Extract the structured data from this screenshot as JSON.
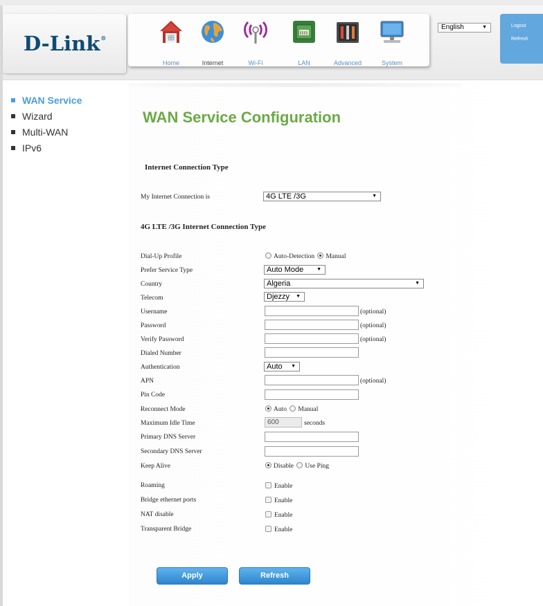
{
  "brand": {
    "logo_text": "D-Link",
    "logo_mark": "®"
  },
  "nav": {
    "items": [
      {
        "label": "Home",
        "icon": "home-icon"
      },
      {
        "label": "Internet",
        "icon": "globe-icon"
      },
      {
        "label": "Wi-Fi",
        "icon": "wifi-icon"
      },
      {
        "label": "LAN",
        "icon": "lan-icon"
      },
      {
        "label": "Advanced",
        "icon": "tools-icon"
      },
      {
        "label": "System",
        "icon": "monitor-icon"
      }
    ],
    "active": "Internet"
  },
  "language": {
    "selected": "English"
  },
  "account": {
    "logout_label": "Logout",
    "refresh_label": "Refresh"
  },
  "sidebar": {
    "items": [
      {
        "label": "WAN Service",
        "active": true
      },
      {
        "label": "Wizard"
      },
      {
        "label": "Multi-WAN"
      },
      {
        "label": "IPv6"
      }
    ]
  },
  "page": {
    "title": "WAN Service Configuration"
  },
  "section1": {
    "title": "Internet Connection Type",
    "connection_label": "My Internet Connection is",
    "connection_value": "4G LTE /3G"
  },
  "section2": {
    "title": "4G LTE /3G Internet Connection Type",
    "dialup": {
      "label": "Dial-Up Profile",
      "opt_auto": "Auto-Detection",
      "opt_manual": "Manual",
      "selected": "Manual"
    },
    "service_type": {
      "label": "Prefer Service Type",
      "value": "Auto Mode"
    },
    "country": {
      "label": "Country",
      "value": "Algeria"
    },
    "telecom": {
      "label": "Telecom",
      "value": "Djezzy"
    },
    "username": {
      "label": "Username",
      "value": "",
      "hint": "(optional)"
    },
    "password": {
      "label": "Password",
      "value": "",
      "hint": "(optional)"
    },
    "verify_password": {
      "label": "Verify Password",
      "value": "",
      "hint": "(optional)"
    },
    "dialed_number": {
      "label": "Dialed Number",
      "value": ""
    },
    "authentication": {
      "label": "Authentication",
      "value": "Auto"
    },
    "apn": {
      "label": "APN",
      "value": "",
      "hint": "(optional)"
    },
    "pin_code": {
      "label": "Pin Code",
      "value": ""
    },
    "reconnect": {
      "label": "Reconnect Mode",
      "opt_auto": "Auto",
      "opt_manual": "Manual",
      "selected": "Auto"
    },
    "idle_time": {
      "label": "Maximum Idle Time",
      "value": "600",
      "unit": "seconds"
    },
    "primary_dns": {
      "label": "Primary DNS Server",
      "value": ""
    },
    "secondary_dns": {
      "label": "Secondary DNS Server",
      "value": ""
    },
    "keep_alive": {
      "label": "Keep Alive",
      "opt_disable": "Disable",
      "opt_ping": "Use Ping",
      "selected": "Disable"
    },
    "roaming": {
      "label": "Roaming",
      "option": "Enable"
    },
    "bridge_ports": {
      "label": "Bridge ethernet ports",
      "option": "Enable"
    },
    "nat_disable": {
      "label": "NAT disable",
      "option": "Enable"
    },
    "transparent_bridge": {
      "label": "Transparent Bridge",
      "option": "Enable"
    }
  },
  "actions": {
    "apply_label": "Apply",
    "refresh_label": "Refresh"
  },
  "colors": {
    "title_green": "#6aaa46",
    "link_blue": "#4a9ce0",
    "button_blue": "#3b93d8",
    "logo_navy": "#0e4b73"
  }
}
